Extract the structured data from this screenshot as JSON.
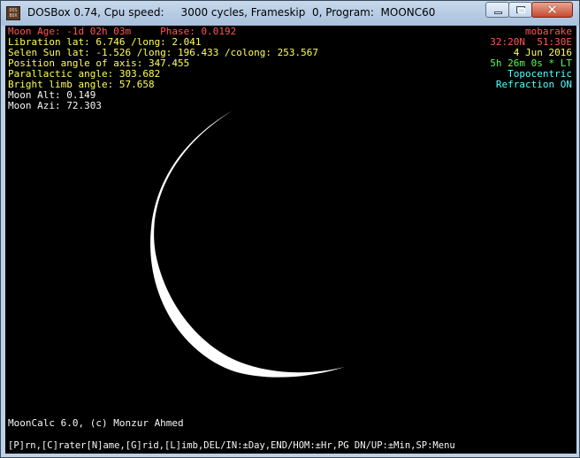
{
  "window": {
    "title": "DOSBox 0.74, Cpu speed:     3000 cycles, Frameskip  0, Program:  MOONC60",
    "app_icon_text": [
      "DOS",
      "BOX"
    ]
  },
  "colors": {
    "red": "#ff5555",
    "yellow": "#ffff55",
    "white": "#f8f8f8",
    "green": "#55ff55",
    "cyan": "#55ffff",
    "background": "#000000"
  },
  "screen": {
    "left_lines": [
      "Moon Age: -1d 02h 03m     Phase: 0.0192",
      "Libration lat: 6.746 /long: 2.041",
      "Selen Sun lat: -1.526 /long: 196.433 /colong: 253.567",
      "Position angle of axis: 347.455",
      "Parallactic angle: 303.682",
      "Bright limb angle: 57.658",
      "Moon Alt: 0.149",
      "Moon Azi: 72.303"
    ],
    "right_lines": [
      "mobarake",
      "32:20N  51:30E",
      "4 Jun 2016",
      "5h 26m 0s * LT",
      "Topocentric",
      "Refraction ON"
    ],
    "credit": "MoonCalc 6.0, (c) Monzur Ahmed",
    "help_bar": "[P]rn,[C]rater[N]ame,[G]rid,[L]imb,DEL/IN:±Day,END/HOM:±Hr,PG DN/UP:±Min,SP:Menu"
  }
}
